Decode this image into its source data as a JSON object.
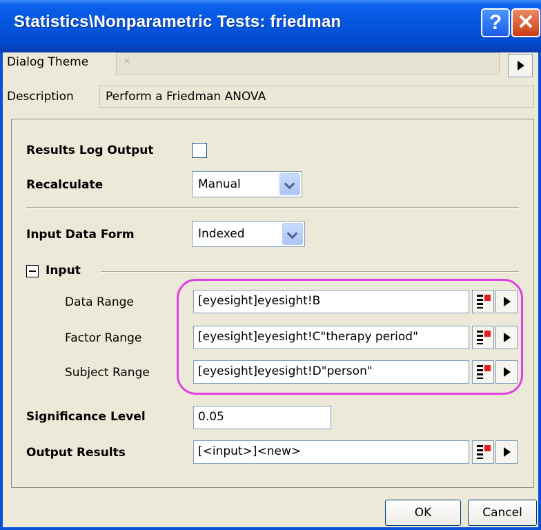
{
  "window": {
    "title": "Statistics\\Nonparametric Tests: friedman",
    "help_label": "?",
    "close_label": "✕"
  },
  "top": {
    "theme_label": "Dialog Theme",
    "theme_value": "×",
    "description_label": "Description",
    "description_value": "Perform a Friedman ANOVA"
  },
  "form": {
    "results_log_label": "Results Log Output",
    "results_log_checked": false,
    "recalculate_label": "Recalculate",
    "recalculate_value": "Manual",
    "input_form_label": "Input Data Form",
    "input_form_value": "Indexed",
    "input_group_label": "Input",
    "data_range_label": "Data Range",
    "data_range_value": "[eyesight]eyesight!B",
    "factor_range_label": "Factor Range",
    "factor_range_value": "[eyesight]eyesight!C\"therapy period\"",
    "subject_range_label": "Subject Range",
    "subject_range_value": "[eyesight]eyesight!D\"person\"",
    "significance_label": "Significance Level",
    "significance_value": "0.05",
    "output_results_label": "Output Results",
    "output_results_value": "[<input>]<new>"
  },
  "buttons": {
    "ok": "OK",
    "cancel": "Cancel"
  },
  "colors": {
    "titlebar": "#0554dd",
    "highlight": "#e040e0",
    "dialog_bg": "#ece9d8"
  }
}
